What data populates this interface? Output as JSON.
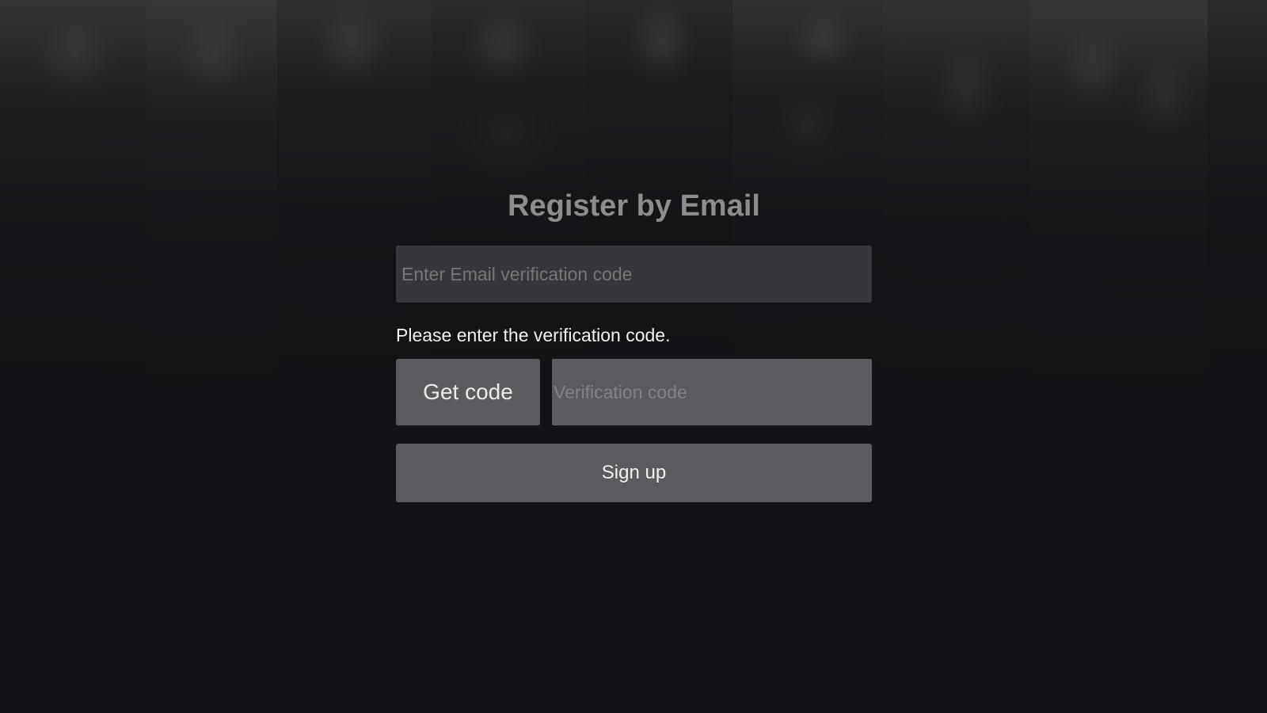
{
  "page": {
    "title": "Register by Email"
  },
  "email_field": {
    "placeholder": "Enter Email verification code",
    "value": ""
  },
  "hint_text": "Please enter the verification code.",
  "get_code_button": {
    "label": "Get code"
  },
  "verification_field": {
    "placeholder": "Verification code",
    "value": ""
  },
  "signup_button": {
    "label": "Sign up"
  },
  "colors": {
    "background": "#121316",
    "field_dark": "#35373a",
    "button": "#5a5b5e",
    "title": "#8d8d8d",
    "text": "#f2f2f2"
  }
}
